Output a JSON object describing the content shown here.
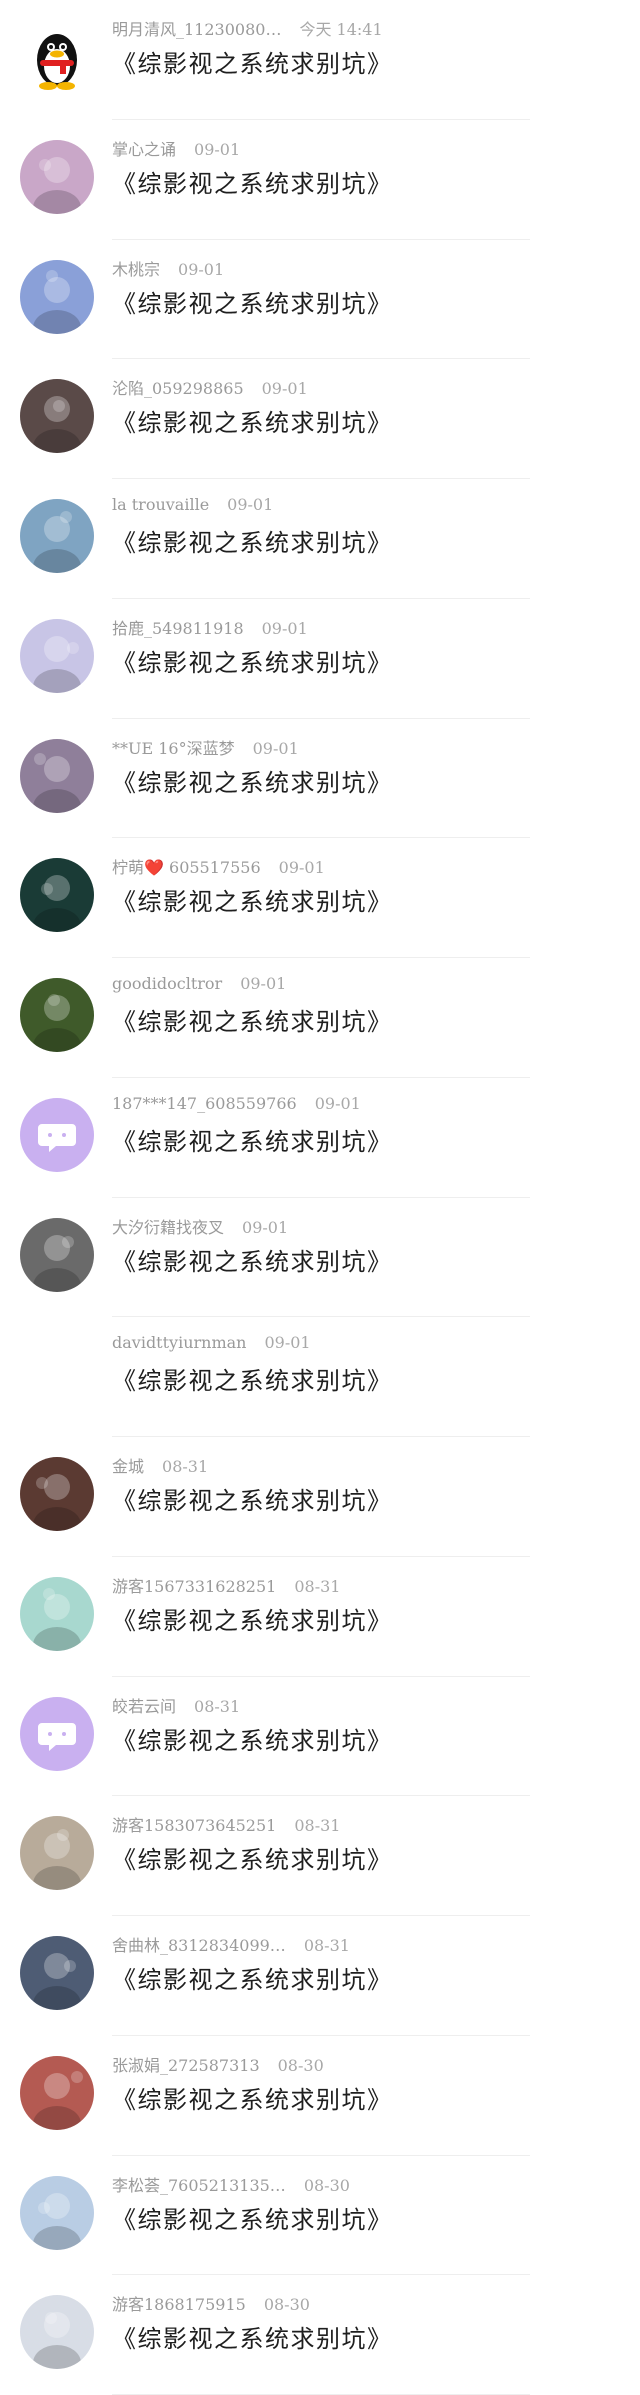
{
  "messages": [
    {
      "name": "明月清风_11230080…",
      "time": "今天 14:41",
      "text": "《综影视之系统求别坑》",
      "avatar": "qq-penguin-icon",
      "color": "#ffffff"
    },
    {
      "name": "掌心之诵",
      "time": "09-01",
      "text": "《综影视之系统求别坑》",
      "avatar": "photo",
      "color": "#c9a7c8"
    },
    {
      "name": "木桃宗",
      "time": "09-01",
      "text": "《综影视之系统求别坑》",
      "avatar": "photo",
      "color": "#8aa0d8"
    },
    {
      "name": "沦陷_059298865",
      "time": "09-01",
      "text": "《综影视之系统求别坑》",
      "avatar": "photo",
      "color": "#5a4a48"
    },
    {
      "name": "la trouvaille",
      "time": "09-01",
      "text": "《综影视之系统求别坑》",
      "avatar": "photo",
      "color": "#7fa4c2"
    },
    {
      "name": "拾鹿_549811918",
      "time": "09-01",
      "text": "《综影视之系统求别坑》",
      "avatar": "photo",
      "color": "#c8c5e6"
    },
    {
      "name": "**UE 16°深蓝梦",
      "time": "09-01",
      "text": "《综影视之系统求别坑》",
      "avatar": "photo",
      "color": "#8f7f9a"
    },
    {
      "name": "柠萌❤️ 605517556",
      "time": "09-01",
      "text": "《综影视之系统求别坑》",
      "avatar": "photo",
      "color": "#1a3b36"
    },
    {
      "name": "goodidocltror",
      "time": "09-01",
      "text": "《综影视之系统求别坑》",
      "avatar": "photo",
      "color": "#3f5a2a"
    },
    {
      "name": "187***147_608559766",
      "time": "09-01",
      "text": "《综影视之系统求别坑》",
      "avatar": "default-chat-icon",
      "color": "#c9b0f0"
    },
    {
      "name": "大汐衍籍找夜叉",
      "time": "09-01",
      "text": "《综影视之系统求别坑》",
      "avatar": "photo",
      "color": "#6a6a6a"
    },
    {
      "name": "davidttyiurnman",
      "time": "09-01",
      "text": "《综影视之系统求别坑》",
      "avatar": "blank",
      "color": "#ffffff"
    },
    {
      "name": "金城",
      "time": "08-31",
      "text": "《综影视之系统求别坑》",
      "avatar": "photo",
      "color": "#5b3a32"
    },
    {
      "name": "游客1567331628251",
      "time": "08-31",
      "text": "《综影视之系统求别坑》",
      "avatar": "photo",
      "color": "#a8d8cf"
    },
    {
      "name": "皎若云间",
      "time": "08-31",
      "text": "《综影视之系统求别坑》",
      "avatar": "default-chat-icon",
      "color": "#c9b0f0"
    },
    {
      "name": "游客1583073645251",
      "time": "08-31",
      "text": "《综影视之系统求别坑》",
      "avatar": "photo",
      "color": "#b8ab9a"
    },
    {
      "name": "舍曲林_8312834099…",
      "time": "08-31",
      "text": "《综影视之系统求别坑》",
      "avatar": "photo",
      "color": "#4e5c74"
    },
    {
      "name": "张淑娟_272587313",
      "time": "08-30",
      "text": "《综影视之系统求别坑》",
      "avatar": "photo",
      "color": "#b45a52"
    },
    {
      "name": "李松荟_7605213135…",
      "time": "08-30",
      "text": "《综影视之系统求别坑》",
      "avatar": "photo",
      "color": "#b9cde4"
    },
    {
      "name": "游客1868175915",
      "time": "08-30",
      "text": "《综影视之系统求别坑》",
      "avatar": "photo",
      "color": "#d8dde6"
    }
  ]
}
